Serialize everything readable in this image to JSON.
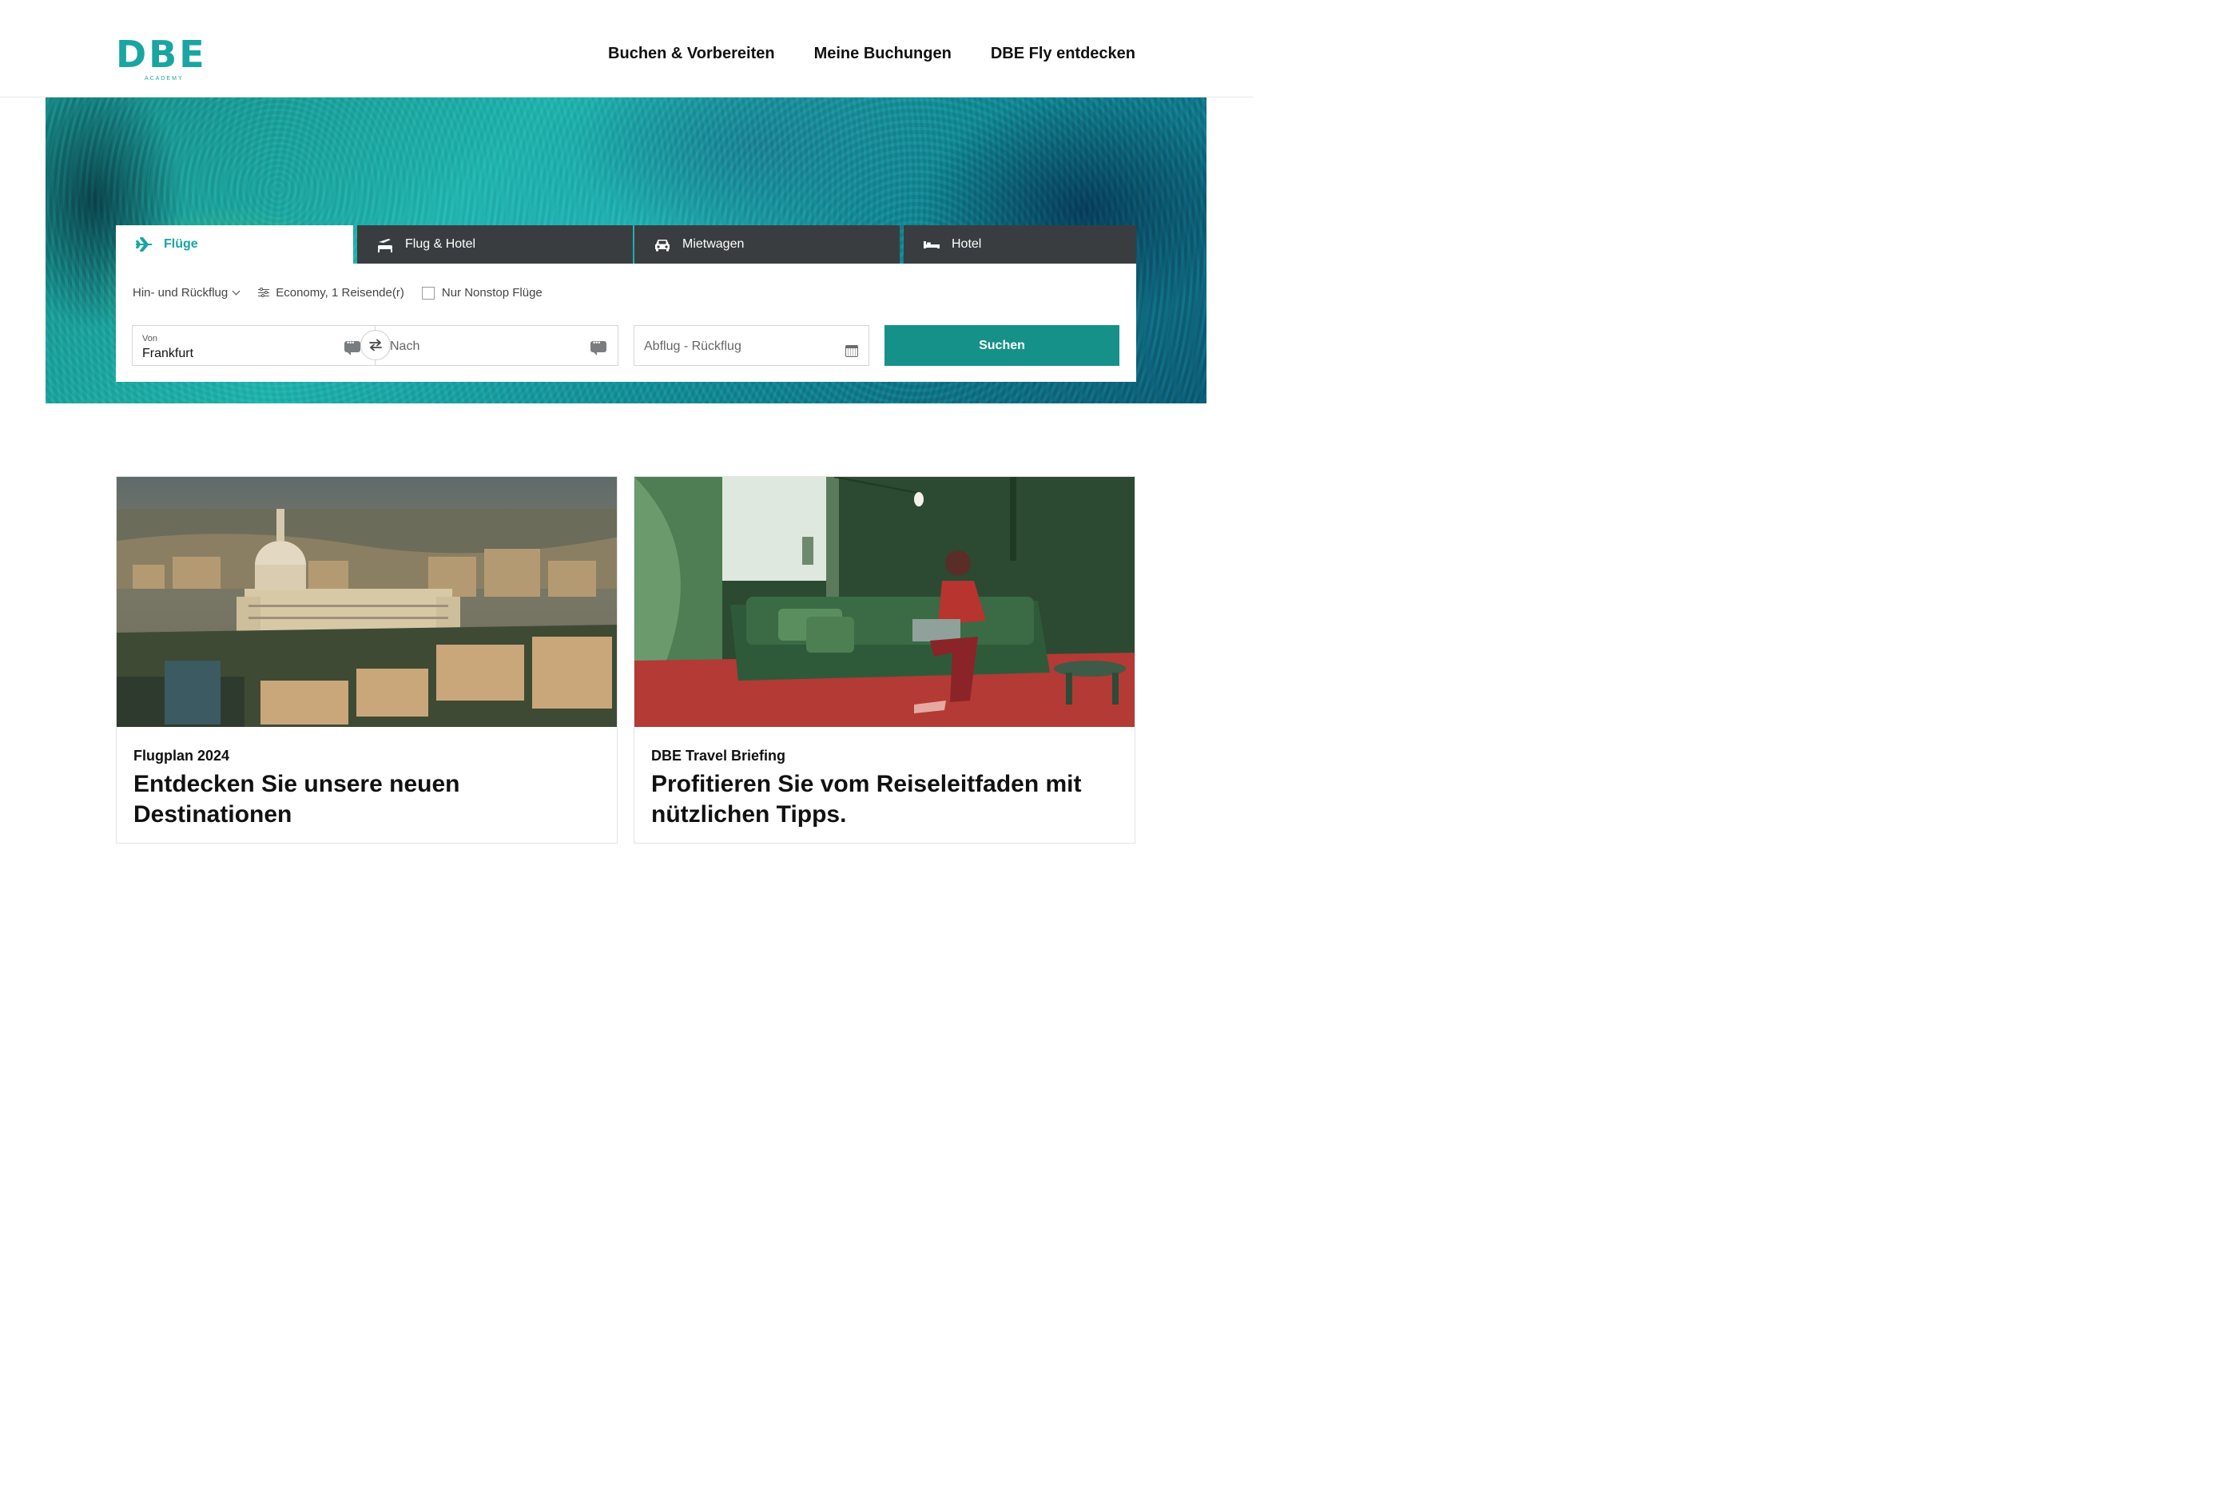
{
  "brand": {
    "logo_text": "DBE",
    "logo_sub": "ACADEMY",
    "color": "#1aa5a2"
  },
  "nav": [
    {
      "label": "Buchen & Vorbereiten"
    },
    {
      "label": "Meine Buchungen"
    },
    {
      "label": "DBE Fly entdecken"
    }
  ],
  "tabs": [
    {
      "label": "Flüge",
      "icon": "airplane-icon",
      "active": true
    },
    {
      "label": "Flug & Hotel",
      "icon": "flight-hotel-icon",
      "active": false
    },
    {
      "label": "Mietwagen",
      "icon": "car-icon",
      "active": false
    },
    {
      "label": "Hotel",
      "icon": "bed-icon",
      "active": false
    }
  ],
  "search": {
    "trip_type": "Hin- und Rückflug",
    "cabin": "Economy, 1 Reisende(r)",
    "nonstop_label": "Nur Nonstop Flüge",
    "nonstop_checked": false,
    "from_label": "Von",
    "from_value": "Frankfurt",
    "to_placeholder": "Nach",
    "dates_placeholder": "Abflug - Rückflug",
    "submit_label": "Suchen",
    "accent": "#15918a"
  },
  "cards": [
    {
      "kicker": "Flugplan 2024",
      "title": "Entdecken Sie unsere neuen Destinationen"
    },
    {
      "kicker": "DBE Travel Briefing",
      "title": "Profitieren Sie vom Reiseleitfaden mit nützlichen Tipps."
    }
  ]
}
